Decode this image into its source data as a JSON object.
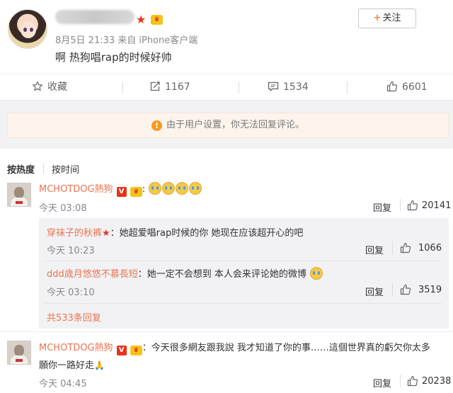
{
  "post": {
    "meta": "8月5日 21:33 来自 iPhone客户端",
    "content": "啊  热狗唱rap的时候好帅",
    "follow_label": "关注",
    "follow_plus": "+"
  },
  "actions": {
    "favorite": "收藏",
    "reposts": "1167",
    "comments": "1534",
    "likes": "6601"
  },
  "notice": "由于用户设置，你无法回复评论。",
  "sort": {
    "hot": "按热度",
    "time": "按时间"
  },
  "comments": [
    {
      "user": "MCHOTDOG熱狗",
      "text_suffix": ":",
      "time": "今天 03:08",
      "reply": "回复",
      "likes": "20141"
    },
    {
      "user": "MCHOTDOG熱狗",
      "text": "：今天很多網友跟我說 我才知道了你的事……這個世界真的虧欠你太多",
      "text2": "願你一路好走",
      "time": "今天 04:45",
      "reply": "回复",
      "likes": "20238"
    }
  ],
  "replies": [
    {
      "user": "穿袜子的秋裤",
      "text": "：她超爱唱rap时候的你 她现在应该超开心的吧",
      "time": "今天 10:23",
      "reply": "回复",
      "likes": "1066"
    },
    {
      "user": "ddd歳月悠悠不慕長短",
      "text": "：她一定不会想到 本人会来评论她的微博",
      "time": "今天 03:10",
      "reply": "回复",
      "likes": "3519"
    }
  ],
  "more_replies": "共533条回复",
  "colors": {
    "accent": "#eb7350",
    "notice_bg": "#fdf5ec",
    "page_gray": "#f2f2f5"
  }
}
